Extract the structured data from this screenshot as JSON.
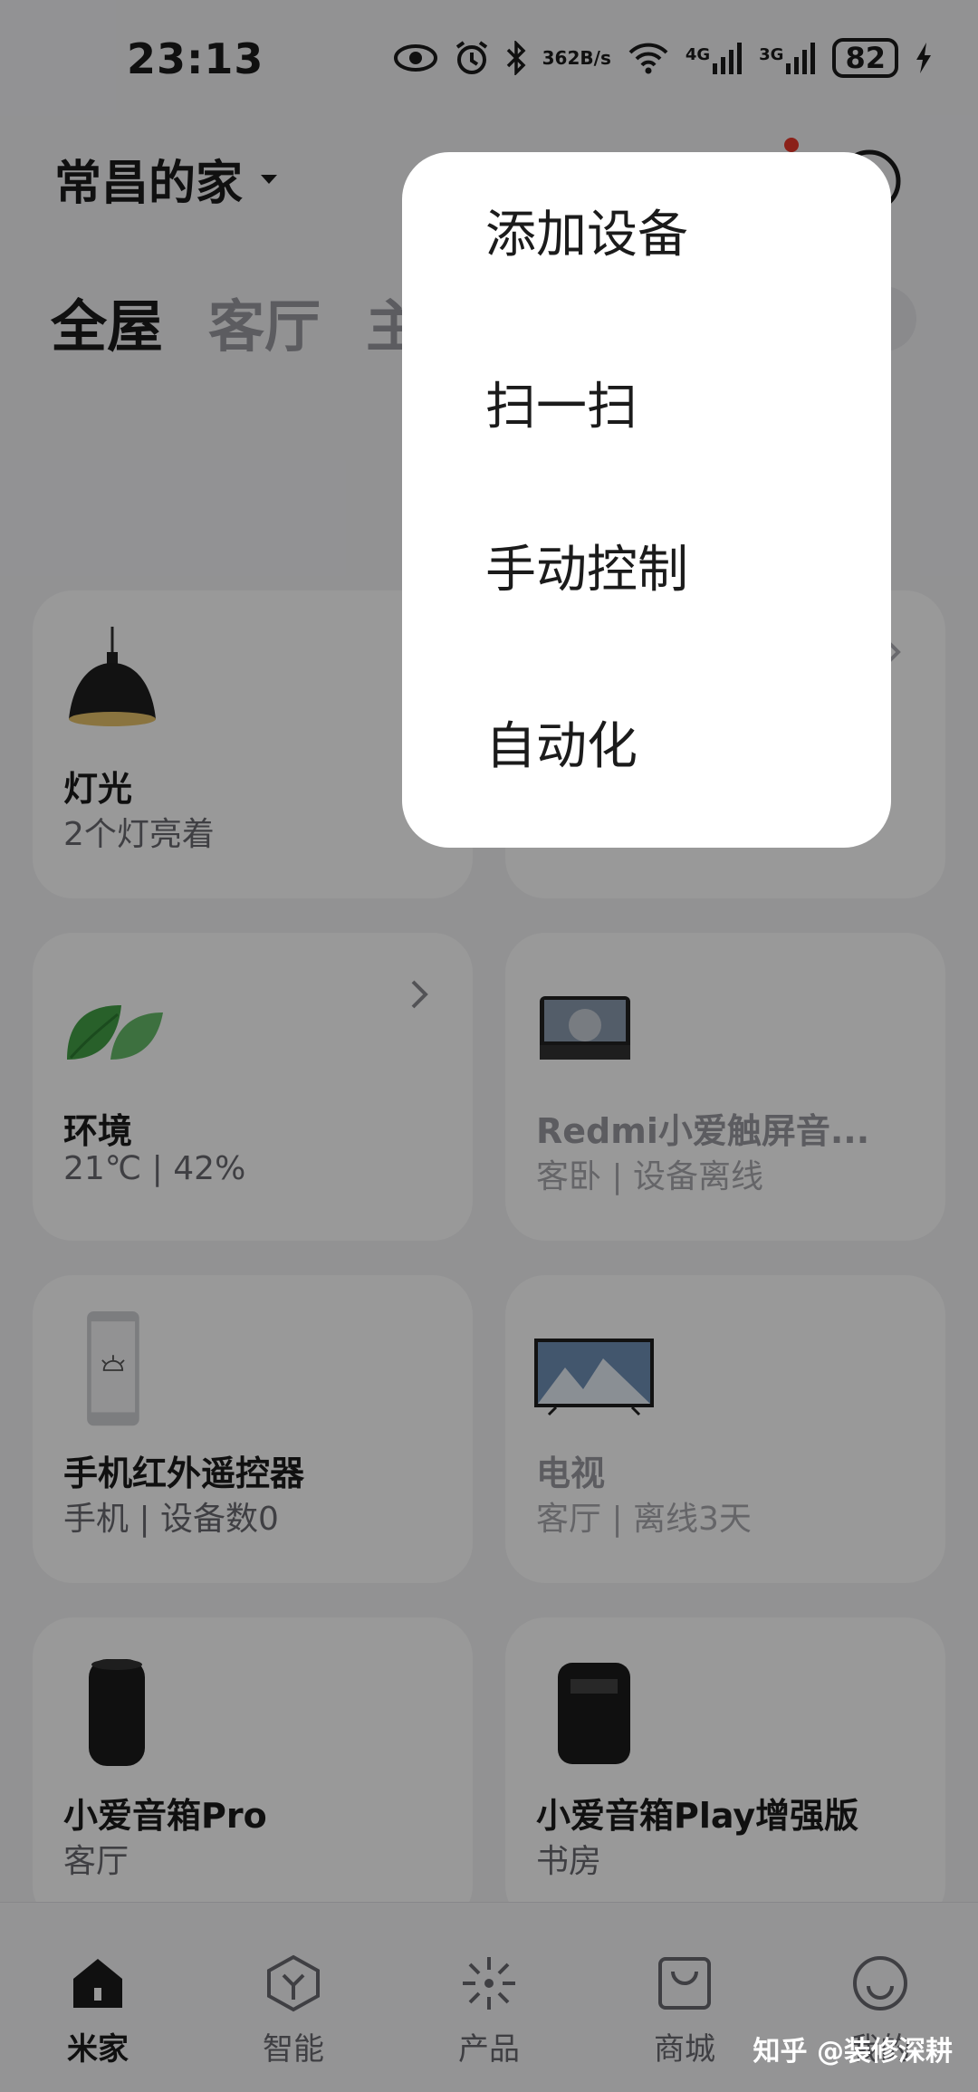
{
  "status_bar": {
    "time": "23:13",
    "net_speed_value": "362",
    "net_speed_unit": "B/s",
    "signal1_label": "4G",
    "signal2_label": "3G",
    "battery": "82",
    "icons": [
      "eye-icon",
      "alarm-icon",
      "bluetooth-icon",
      "wifi-icon",
      "signal-icon",
      "charging-icon"
    ]
  },
  "header": {
    "home_name": "常昌的家"
  },
  "room_tabs": [
    "全屋",
    "客厅",
    "主"
  ],
  "cards": [
    {
      "title": "灯光",
      "subtitle": "2个灯亮着",
      "icon": "lamp-icon"
    },
    {
      "title": "",
      "subtitle": "",
      "icon": ""
    },
    {
      "title": "环境",
      "subtitle": "21℃ | 42%",
      "icon": "leaf-icon"
    },
    {
      "title": "Redmi小爱触屏音...",
      "subtitle": "客卧 | 设备离线",
      "icon": "smart-display-icon"
    },
    {
      "title": "手机红外遥控器",
      "subtitle": "手机 | 设备数0",
      "icon": "phone-remote-icon"
    },
    {
      "title": "电视",
      "subtitle": "客厅 | 离线3天",
      "icon": "tv-icon"
    },
    {
      "title": "小爱音箱Pro",
      "subtitle": "客厅",
      "icon": "speaker-icon"
    },
    {
      "title": "小爱音箱Play增强版",
      "subtitle": "书房",
      "icon": "clock-speaker-icon"
    }
  ],
  "popup_menu": {
    "items": [
      "添加设备",
      "扫一扫",
      "手动控制",
      "自动化"
    ]
  },
  "bottom_nav": [
    {
      "label": "米家",
      "icon": "home-icon"
    },
    {
      "label": "智能",
      "icon": "smart-icon"
    },
    {
      "label": "产品",
      "icon": "product-icon"
    },
    {
      "label": "商城",
      "icon": "shop-icon"
    },
    {
      "label": "我的",
      "icon": "profile-icon"
    }
  ],
  "watermark": "知乎 @装修深耕",
  "colors": {
    "accent_red": "#e8372a",
    "leaf_green": "#4caf50",
    "overlay": "rgba(0,0,0,0.4)"
  }
}
